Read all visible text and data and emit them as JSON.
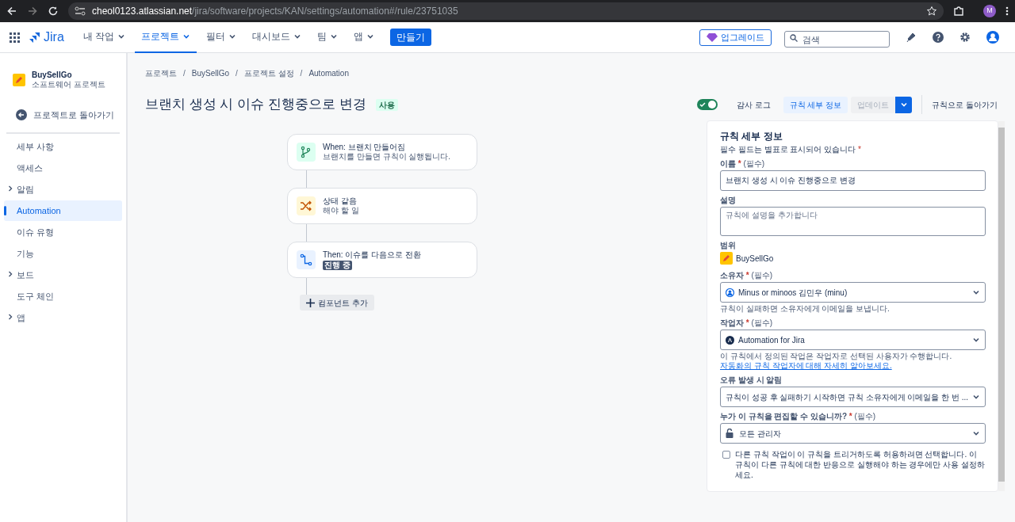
{
  "browser": {
    "url_host": "cheol0123.atlassian.net",
    "url_path": "/jira/software/projects/KAN/settings/automation#/rule/23751035",
    "avatar_letter": "M"
  },
  "topnav": {
    "product": "Jira",
    "items": [
      {
        "label": "내 작업",
        "selected": false
      },
      {
        "label": "프로젝트",
        "selected": true
      },
      {
        "label": "필터",
        "selected": false
      },
      {
        "label": "대시보드",
        "selected": false
      },
      {
        "label": "팀",
        "selected": false
      },
      {
        "label": "앱",
        "selected": false
      }
    ],
    "create": "만들기",
    "upgrade": "업그레이드",
    "search_placeholder": "검색"
  },
  "sidebar": {
    "project_name": "BuySellGo",
    "project_type": "소프트웨어 프로젝트",
    "back": "프로젝트로 돌아가기",
    "items": [
      {
        "label": "세부 사항",
        "selected": false,
        "expandable": false
      },
      {
        "label": "액세스",
        "selected": false,
        "expandable": false
      },
      {
        "label": "알림",
        "selected": false,
        "expandable": true
      },
      {
        "label": "Automation",
        "selected": true,
        "expandable": false
      },
      {
        "label": "이슈 유형",
        "selected": false,
        "expandable": false
      },
      {
        "label": "기능",
        "selected": false,
        "expandable": false
      },
      {
        "label": "보드",
        "selected": false,
        "expandable": true
      },
      {
        "label": "도구 체인",
        "selected": false,
        "expandable": false
      },
      {
        "label": "앱",
        "selected": false,
        "expandable": true
      }
    ]
  },
  "breadcrumbs": [
    "프로젝트",
    "BuySellGo",
    "프로젝트 설정",
    "Automation"
  ],
  "breadcrumb_separator": "/",
  "rule": {
    "title": "브랜치 생성 시 이슈 진행중으로 변경",
    "badge": "사용",
    "enabled": true,
    "audit_log": "감사 로그",
    "details": "규칙 세부 정보",
    "update": "업데이트",
    "back": "규칙으로 돌아가기"
  },
  "flow": {
    "nodes": [
      {
        "kind": "trigger",
        "title": "When: 브랜치 만들어짐",
        "subtitle": "브랜치를 만들면 규칙이 실행됩니다."
      },
      {
        "kind": "condition",
        "title": "상태 같음",
        "subtitle": "해야 할 일"
      },
      {
        "kind": "action",
        "title": "Then: 이슈를 다음으로 전환",
        "tag": "진행 중"
      }
    ],
    "add_component": "컴포넌트 추가"
  },
  "panel": {
    "heading": "규칙 세부 정보",
    "required_note": "필수 필드는 별표로 표시되어 있습니다",
    "required_mark": "*",
    "name": {
      "label": "이름",
      "required_text": "(필수)",
      "value": "브랜치 생성 시 이슈 진행중으로 변경"
    },
    "description": {
      "label": "설명",
      "placeholder": "규칙에 설명을 추가합니다"
    },
    "scope": {
      "label": "범위",
      "value": "BuySellGo"
    },
    "owner": {
      "label": "소유자",
      "required_text": "(필수)",
      "value": "Minus or minoos 김민우 (minu)",
      "help": "규칙이 실패하면 소유자에게 이메일을 보냅니다."
    },
    "actor": {
      "label": "작업자",
      "required_text": "(필수)",
      "value": "Automation for Jira",
      "help": "이 규칙에서 정의된 작업은 작업자로 선택된 사용자가 수행합니다.",
      "link": "자동화의 규칙 작업자에 대해 자세히 알아보세요."
    },
    "notify": {
      "label": "오류 발생 시 알림",
      "value": "규칙이 성공 후 실패하기 시작하면 규칙 소유자에게 이메일을 한 번 ..."
    },
    "editors": {
      "label": "누가 이 규칙을 편집할 수 있습니까?",
      "required_text": "(필수)",
      "value": "모든 관리자"
    },
    "allow_trigger": {
      "label": "다른 규칙 작업이 이 규칙을 트리거하도록 허용하려면 선택합니다. 이 규칙이 다른 규칙에 대한 반응으로 실행해야 하는 경우에만 사용 설정하세요.",
      "checked": false
    }
  }
}
